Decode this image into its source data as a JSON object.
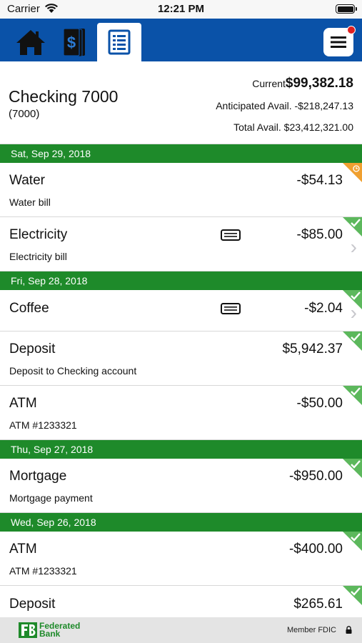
{
  "status_bar": {
    "carrier": "Carrier",
    "time": "12:21 PM"
  },
  "nav": {
    "tabs": [
      "home-icon",
      "money-icon",
      "register-icon"
    ],
    "active_tab": "register-icon",
    "menu_icon": "hamburger-icon",
    "notification": true
  },
  "account": {
    "name": "Checking 7000",
    "number": "(7000)",
    "current_label": "Current",
    "current_amount": "$99,382.18",
    "anticipated": "Anticipated Avail. -$218,247.13",
    "total": "Total Avail. $23,412,321.00"
  },
  "groups": [
    {
      "date": "Sat, Sep 29, 2018",
      "transactions": [
        {
          "desc": "Water",
          "memo": "Water bill",
          "amount": "-$54.13",
          "status": "pending",
          "receipt": false,
          "chevron": false
        },
        {
          "desc": "Electricity",
          "memo": "Electricity bill",
          "amount": "-$85.00",
          "status": "cleared",
          "receipt": true,
          "chevron": true
        }
      ]
    },
    {
      "date": "Fri, Sep 28, 2018",
      "transactions": [
        {
          "desc": "Coffee",
          "memo": "",
          "amount": "-$2.04",
          "status": "cleared",
          "receipt": true,
          "chevron": true
        },
        {
          "desc": "Deposit",
          "memo": "Deposit to Checking account",
          "amount": "$5,942.37",
          "status": "cleared",
          "receipt": false,
          "chevron": false
        },
        {
          "desc": "ATM",
          "memo": "ATM #1233321",
          "amount": "-$50.00",
          "status": "cleared",
          "receipt": false,
          "chevron": false
        }
      ]
    },
    {
      "date": "Thu, Sep 27, 2018",
      "transactions": [
        {
          "desc": "Mortgage",
          "memo": "Mortgage payment",
          "amount": "-$950.00",
          "status": "cleared",
          "receipt": false,
          "chevron": false
        }
      ]
    },
    {
      "date": "Wed, Sep 26, 2018",
      "transactions": [
        {
          "desc": "ATM",
          "memo": "ATM #1233321",
          "amount": "-$400.00",
          "status": "cleared",
          "receipt": false,
          "chevron": false
        },
        {
          "desc": "Deposit",
          "memo": "",
          "amount": "$265.61",
          "status": "cleared",
          "receipt": false,
          "chevron": false
        }
      ]
    }
  ],
  "footer": {
    "logo_line1": "Federated",
    "logo_line2": "Bank",
    "fdic": "Member FDIC"
  },
  "colors": {
    "nav": "#0a52a8",
    "date_header": "#1e8a2a",
    "cleared": "#5cb85c",
    "pending": "#f0a030"
  }
}
